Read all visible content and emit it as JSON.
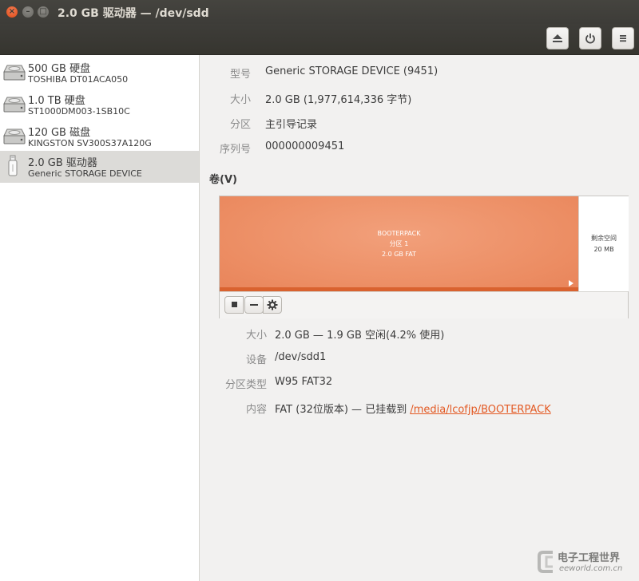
{
  "window": {
    "title": "2.0 GB 驱动器 — /dev/sdd",
    "close_glyph": "×",
    "minimize_glyph": "–",
    "maximize_glyph": "□"
  },
  "toolbar": {
    "eject_icon": "eject-icon",
    "power_icon": "power-icon",
    "menu_icon": "menu-icon"
  },
  "sidebar": {
    "items": [
      {
        "name": "500 GB 硬盘",
        "model": "TOSHIBA DT01ACA050",
        "icon": "hard-disk-icon",
        "selected": false
      },
      {
        "name": "1.0 TB 硬盘",
        "model": "ST1000DM003-1SB10C",
        "icon": "hard-disk-icon",
        "selected": false
      },
      {
        "name": "120 GB 磁盘",
        "model": "KINGSTON SV300S37A120G",
        "icon": "hard-disk-icon",
        "selected": false
      },
      {
        "name": "2.0 GB 驱动器",
        "model": "Generic STORAGE DEVICE",
        "icon": "usb-drive-icon",
        "selected": true
      }
    ]
  },
  "drive_info": {
    "model_label": "型号",
    "model_value": "Generic STORAGE DEVICE (9451)",
    "size_label": "大小",
    "size_value": "2.0 GB (1,977,614,336 字节)",
    "partitioning_label": "分区",
    "partitioning_value": "主引导记录",
    "serial_label": "序列号",
    "serial_value": "000000009451"
  },
  "volumes": {
    "heading": "卷(V)",
    "partition": {
      "name": "BOOTERPACK",
      "number": "分区 1",
      "desc": "2.0 GB FAT",
      "color": "#ec8d63"
    },
    "free_space": {
      "label": "剩余空间",
      "size": "20 MB"
    }
  },
  "volume_info": {
    "size_label": "大小",
    "size_value": "2.0 GB — 1.9 GB 空闲(4.2% 使用)",
    "device_label": "设备",
    "device_value": "/dev/sdd1",
    "type_label": "分区类型",
    "type_value": "W95 FAT32",
    "contents_label": "内容",
    "contents_prefix": "FAT (32位版本) — 已挂载到 ",
    "contents_link": "/media/lcofjp/BOOTERPACK"
  },
  "watermark": {
    "line1": "电子工程世界",
    "line2": "eeworld.com.cn"
  }
}
